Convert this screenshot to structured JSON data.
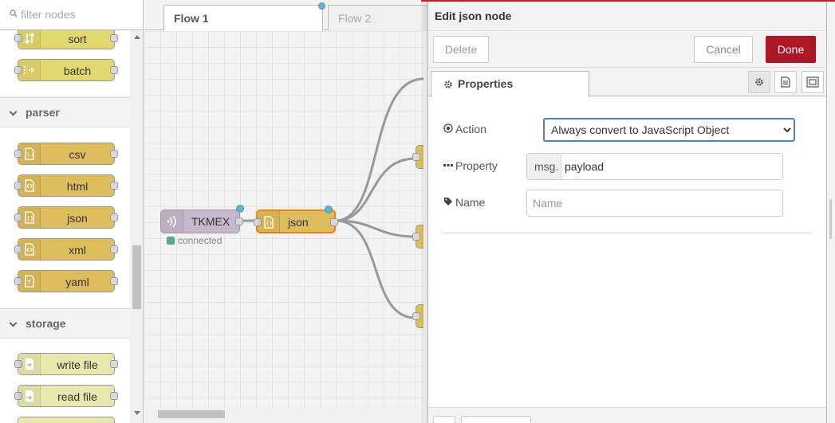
{
  "palette": {
    "search_placeholder": "filter nodes",
    "top_nodes": [
      {
        "label": "sort"
      },
      {
        "label": "batch"
      }
    ],
    "categories": [
      {
        "label": "parser",
        "nodes": [
          {
            "label": "csv"
          },
          {
            "label": "html"
          },
          {
            "label": "json"
          },
          {
            "label": "xml"
          },
          {
            "label": "yaml"
          }
        ]
      },
      {
        "label": "storage",
        "nodes": [
          {
            "label": "write file"
          },
          {
            "label": "read file"
          }
        ]
      }
    ]
  },
  "workspace": {
    "tabs": [
      {
        "label": "Flow 1"
      },
      {
        "label": "Flow 2"
      }
    ],
    "nodes": [
      {
        "label": "TKMEX",
        "status": "connected"
      },
      {
        "label": "json"
      }
    ]
  },
  "tray": {
    "title": "Edit json node",
    "delete_label": "Delete",
    "cancel_label": "Cancel",
    "done_label": "Done",
    "tab_label": "Properties",
    "fields": {
      "action": {
        "label": "Action",
        "value": "Always convert to JavaScript Object",
        "options": [
          "Always convert to JavaScript Object"
        ]
      },
      "property": {
        "label": "Property",
        "prefix": "msg.",
        "value": "payload"
      },
      "name": {
        "label": "Name",
        "value": "",
        "placeholder": "Name"
      }
    }
  },
  "colors": {
    "done_button": "#ad1625",
    "sequence_node": "#e2d96e",
    "parser_node": "#debd5c",
    "storage_node": "#e7e7ae",
    "changed_indicator": "#5ab7d9",
    "status_connected": "#55aa88"
  }
}
